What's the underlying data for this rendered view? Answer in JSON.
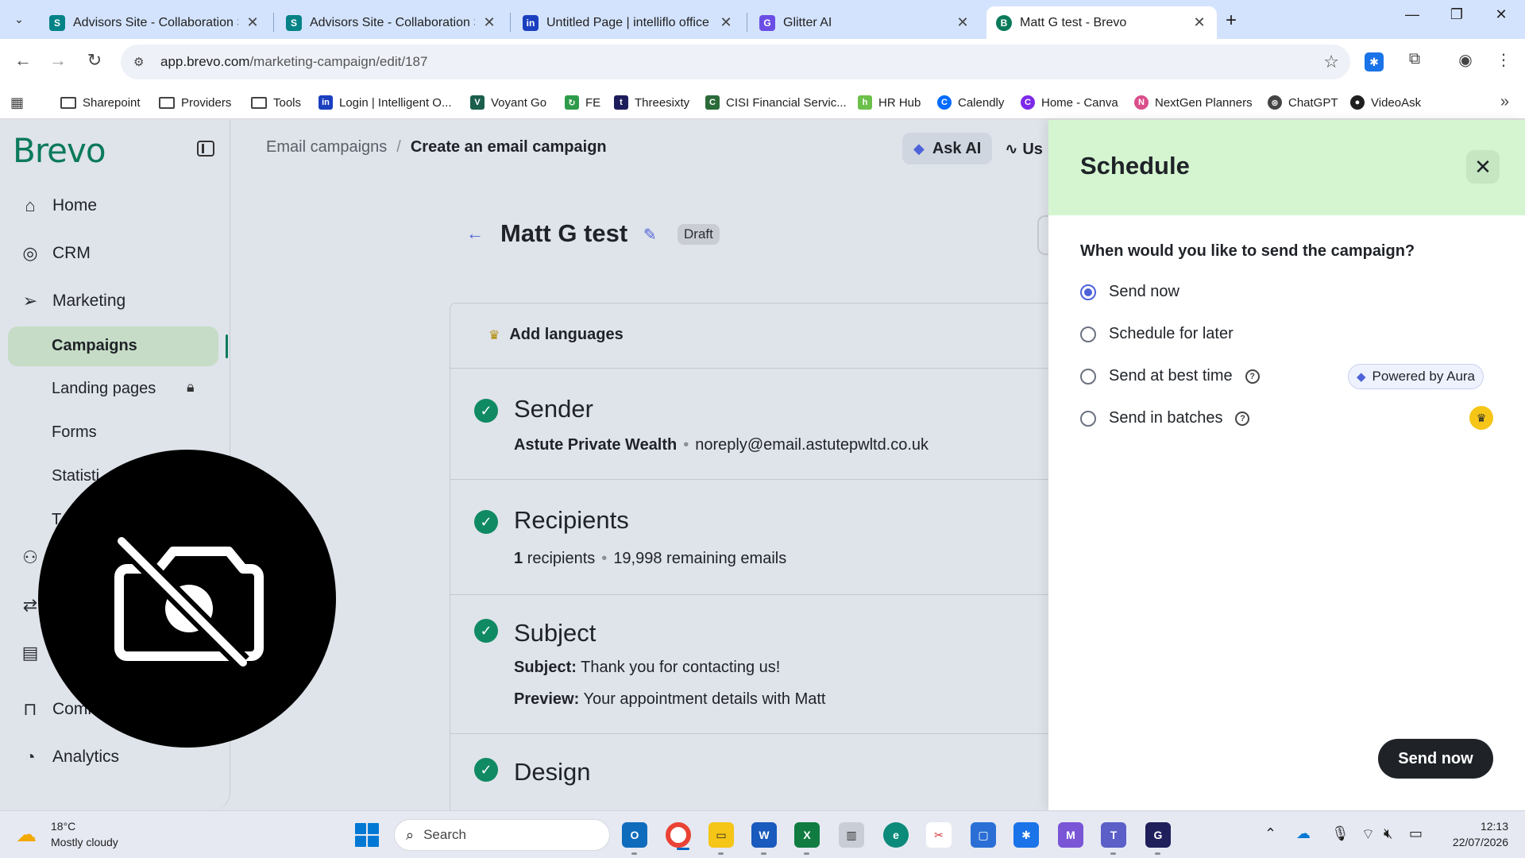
{
  "browser": {
    "tabs": [
      {
        "title": "Advisors Site - Collaboration Sit",
        "icon": "sharepoint-icon",
        "color": "#038387"
      },
      {
        "title": "Advisors Site - Collaboration Sit",
        "icon": "sharepoint-icon",
        "color": "#038387"
      },
      {
        "title": "Untitled Page | intelliflo office",
        "icon": "intelliflo-icon",
        "color": "#1a3fbf"
      },
      {
        "title": "Glitter AI",
        "icon": "glitter-icon",
        "color": "#6b4de6"
      },
      {
        "title": "Matt G test - Brevo",
        "icon": "brevo-icon",
        "color": "#0a7a5a"
      }
    ],
    "url_host": "app.brevo.com",
    "url_path": "/marketing-campaign/edit/187",
    "bookmarks": [
      {
        "label": "Sharepoint",
        "type": "folder"
      },
      {
        "label": "Providers",
        "type": "folder"
      },
      {
        "label": "Tools",
        "type": "folder"
      },
      {
        "label": "Login | Intelligent O...",
        "type": "site",
        "color": "#1a3fbf",
        "glyph": "in"
      },
      {
        "label": "Voyant Go",
        "type": "site",
        "color": "#1b5e4b",
        "glyph": "V"
      },
      {
        "label": "FE",
        "type": "site",
        "color": "#2e9c4a",
        "glyph": "↻"
      },
      {
        "label": "Threesixty",
        "type": "site",
        "color": "#1c1c5c",
        "glyph": "t"
      },
      {
        "label": "CISI Financial Servic...",
        "type": "site",
        "color": "#2b6b3a",
        "glyph": "C"
      },
      {
        "label": "HR Hub",
        "type": "site",
        "color": "#6cc04a",
        "glyph": "h"
      },
      {
        "label": "Calendly",
        "type": "site",
        "color": "#006bff",
        "glyph": "C"
      },
      {
        "label": "Home - Canva",
        "type": "site",
        "color": "#7d2ae8",
        "glyph": "C"
      },
      {
        "label": "NextGen Planners",
        "type": "site",
        "color": "#d94f8b",
        "glyph": "N"
      },
      {
        "label": "ChatGPT",
        "type": "site",
        "color": "#444444",
        "glyph": "⊛"
      },
      {
        "label": "VideoAsk",
        "type": "site",
        "color": "#1f1f1f",
        "glyph": "●"
      }
    ]
  },
  "sidebar": {
    "logo": "Brevo",
    "items": [
      {
        "label": "Home",
        "icon": "home-icon"
      },
      {
        "label": "CRM",
        "icon": "crm-icon"
      },
      {
        "label": "Marketing",
        "icon": "paper-plane-icon"
      }
    ],
    "sub_items": [
      {
        "label": "Campaigns",
        "active": true
      },
      {
        "label": "Landing pages",
        "locked": true
      },
      {
        "label": "Forms"
      },
      {
        "label": "Statisti"
      },
      {
        "label": "T"
      }
    ],
    "bottom_items": [
      {
        "label": "Comm",
        "icon": "shopping-bag-icon"
      },
      {
        "label": "Analytics",
        "icon": "analytics-icon"
      }
    ]
  },
  "main": {
    "breadcrumb_parent": "Email campaigns",
    "breadcrumb_sep": "/",
    "breadcrumb_current": "Create an email campaign",
    "ask_ai": "Ask AI",
    "usage_label": "Us",
    "campaign_name": "Matt G test",
    "status": "Draft",
    "add_languages": "Add languages",
    "sender": {
      "title": "Sender",
      "name": "Astute Private Wealth",
      "email": "noreply@email.astutepwltd.co.uk"
    },
    "recipients": {
      "title": "Recipients",
      "count": "1",
      "count_suffix": "recipients",
      "remaining": "19,998 remaining emails"
    },
    "subject": {
      "title": "Subject",
      "subject_label": "Subject:",
      "subject_value": "Thank you for contacting us!",
      "preview_label": "Preview:",
      "preview_value": "Your appointment details with Matt"
    },
    "design": {
      "title": "Design"
    }
  },
  "schedule_panel": {
    "title": "Schedule",
    "question": "When would you like to send the campaign?",
    "options": [
      {
        "label": "Send now",
        "selected": true
      },
      {
        "label": "Schedule for later",
        "selected": false
      },
      {
        "label": "Send at best time",
        "selected": false,
        "help": true
      },
      {
        "label": "Send in batches",
        "selected": false,
        "help": true
      }
    ],
    "aura_badge": "Powered by Aura",
    "send_button": "Send now",
    "header_color": "#d4f5d0",
    "accent_color": "#4e63d9"
  },
  "taskbar": {
    "weather_temp": "18°C",
    "weather_desc": "Mostly cloudy",
    "search_label": "Search",
    "time": "12:13",
    "date": "22/07/2026"
  }
}
